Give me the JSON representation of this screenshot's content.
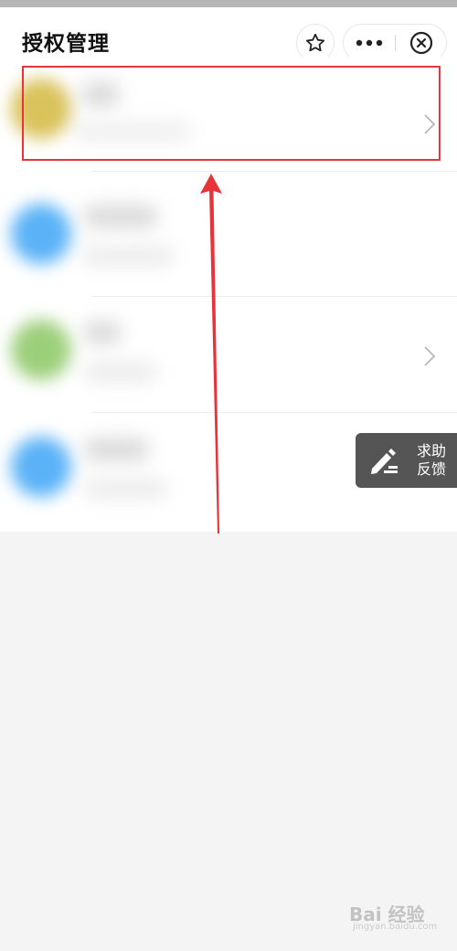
{
  "header": {
    "title": "授权管理",
    "favorite_icon": "star-icon",
    "more_icon": "more-dots-icon",
    "close_icon": "close-circle-icon"
  },
  "list": {
    "items": [
      {
        "avatar_color": "#d9c25a",
        "highlighted": true,
        "chevron": true
      },
      {
        "avatar_color": "#5ab2f7",
        "highlighted": false,
        "chevron": false
      },
      {
        "avatar_color": "#9ccf7a",
        "highlighted": false,
        "chevron": true
      },
      {
        "avatar_color": "#5ab2f7",
        "highlighted": false,
        "chevron": false
      }
    ]
  },
  "feedback": {
    "label_line1": "求助",
    "label_line2": "反馈",
    "icon": "pencil-icon"
  },
  "annotation": {
    "highlight_color": "#e8333a",
    "arrow_color": "#e8333a"
  },
  "watermark": {
    "brand": "Bai 经验",
    "url": "jingyan.baidu.com"
  }
}
